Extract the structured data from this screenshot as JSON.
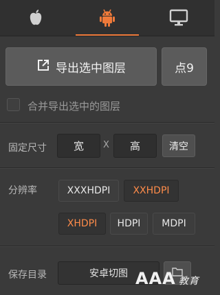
{
  "tabs": [
    {
      "icon": "apple-icon"
    },
    {
      "icon": "android-icon",
      "active": true
    },
    {
      "icon": "monitor-icon"
    }
  ],
  "export": {
    "label": "导出选中图层",
    "icon": "export-icon"
  },
  "dot9": {
    "label": "点9"
  },
  "merge": {
    "label": "合并导出选中的图层",
    "checked": false
  },
  "size": {
    "label": "固定尺寸",
    "width_value": "宽",
    "separator": "X",
    "height_value": "高",
    "clear": "清空"
  },
  "resolution": {
    "label": "分辨率",
    "options": [
      {
        "label": "XXXHDPI",
        "selected": false
      },
      {
        "label": "XXHDPI",
        "selected": true
      },
      {
        "label": "XHDPI",
        "selected": true
      },
      {
        "label": "HDPI",
        "selected": false
      },
      {
        "label": "MDPI",
        "selected": false
      }
    ]
  },
  "save": {
    "label": "保存目录",
    "value": "安卓切图"
  },
  "watermark": {
    "text": "AAA",
    "sub": "教育"
  },
  "colors": {
    "accent": "#ef7a3a",
    "selected_text": "#ff8c4a",
    "background": "#3a3a3a"
  }
}
